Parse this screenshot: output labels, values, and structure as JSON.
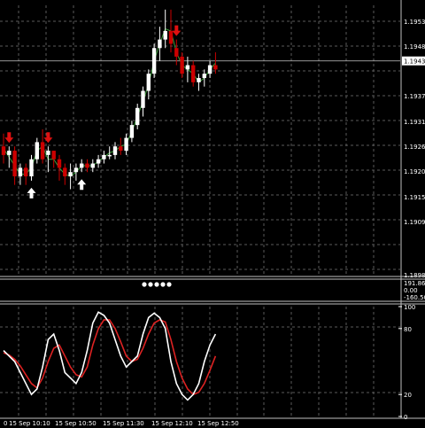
{
  "colors": {
    "background": "#000000",
    "grid": "#5a5a5a",
    "bull_candle": "#ffffff",
    "bear_candle": "#cc0000",
    "signal_line": "#3aa03a",
    "sell_arrow": "#e01010",
    "buy_arrow": "#ffffff",
    "stoch_main": "#ffffff",
    "stoch_signal": "#dd2222",
    "separator": "#c0c0c0"
  },
  "price_panel": {
    "ticks": [
      "1.1953",
      "1.1948",
      "1.1943",
      "1.1937",
      "1.1931",
      "1.1926",
      "1.1920",
      "1.1915",
      "1.1909",
      "1.1898"
    ],
    "current_price_label": "1.1943"
  },
  "middle_panel": {
    "ticks": [
      "191.86",
      "0.00",
      "-160.50"
    ],
    "dots": 5
  },
  "stochastic_panel": {
    "ticks": [
      "100",
      "80",
      "20",
      "0"
    ]
  },
  "time_axis": {
    "labels": [
      "0",
      "15 Sep 10:10",
      "15 Sep 10:50",
      "15 Sep 11:30",
      "15 Sep 12:10",
      "15 Sep 12:50"
    ]
  },
  "chart_data": {
    "type": "candlestick",
    "y_range": [
      1.1893,
      1.1956
    ],
    "candles": [
      [
        1.1923,
        1.1926,
        1.1919,
        1.1921
      ],
      [
        1.1921,
        1.1923,
        1.1918,
        1.1922
      ],
      [
        1.1922,
        1.1923,
        1.1914,
        1.1916
      ],
      [
        1.1916,
        1.1919,
        1.1914,
        1.1918
      ],
      [
        1.1918,
        1.1919,
        1.1914,
        1.1916
      ],
      [
        1.1916,
        1.1921,
        1.1915,
        1.192
      ],
      [
        1.192,
        1.1925,
        1.1919,
        1.1924
      ],
      [
        1.1924,
        1.1927,
        1.1919,
        1.192
      ],
      [
        1.1921,
        1.1923,
        1.1917,
        1.1922
      ],
      [
        1.1922,
        1.1922,
        1.1918,
        1.192
      ],
      [
        1.192,
        1.1921,
        1.1915,
        1.1918
      ],
      [
        1.1918,
        1.1919,
        1.1914,
        1.1916
      ],
      [
        1.1916,
        1.1919,
        1.1913,
        1.1917
      ],
      [
        1.1917,
        1.1919,
        1.1915,
        1.1918
      ],
      [
        1.1918,
        1.192,
        1.1917,
        1.1919
      ],
      [
        1.1919,
        1.192,
        1.1917,
        1.1918
      ],
      [
        1.1918,
        1.192,
        1.1917,
        1.1919
      ],
      [
        1.1919,
        1.1921,
        1.1918,
        1.192
      ],
      [
        1.192,
        1.1922,
        1.1919,
        1.1921
      ],
      [
        1.1921,
        1.1923,
        1.192,
        1.1921
      ],
      [
        1.1921,
        1.1924,
        1.192,
        1.1923
      ],
      [
        1.1923,
        1.1925,
        1.1921,
        1.1922
      ],
      [
        1.1922,
        1.1926,
        1.1921,
        1.1925
      ],
      [
        1.1925,
        1.1929,
        1.1924,
        1.1928
      ],
      [
        1.1928,
        1.1933,
        1.1927,
        1.1932
      ],
      [
        1.1932,
        1.1937,
        1.193,
        1.1936
      ],
      [
        1.1936,
        1.1941,
        1.1934,
        1.194
      ],
      [
        1.194,
        1.1947,
        1.1939,
        1.1946
      ],
      [
        1.1946,
        1.1951,
        1.1943,
        1.1948
      ],
      [
        1.1948,
        1.1955,
        1.1946,
        1.195
      ],
      [
        1.195,
        1.1955,
        1.1945,
        1.1947
      ],
      [
        1.1946,
        1.1948,
        1.1942,
        1.1944
      ],
      [
        1.1944,
        1.1945,
        1.1939,
        1.194
      ],
      [
        1.1941,
        1.1944,
        1.1938,
        1.1942
      ],
      [
        1.1942,
        1.1943,
        1.1937,
        1.1938
      ],
      [
        1.1938,
        1.194,
        1.1936,
        1.1939
      ],
      [
        1.1939,
        1.1941,
        1.1937,
        1.194
      ],
      [
        1.194,
        1.1943,
        1.1939,
        1.1942
      ],
      [
        1.1942,
        1.1945,
        1.194,
        1.1941
      ]
    ],
    "sell_arrows": [
      1,
      8,
      31
    ],
    "buy_arrows": [
      5,
      14
    ],
    "stoch_main": [
      60,
      55,
      50,
      40,
      30,
      20,
      25,
      45,
      70,
      75,
      60,
      40,
      35,
      30,
      40,
      60,
      85,
      95,
      92,
      85,
      70,
      55,
      45,
      50,
      55,
      75,
      90,
      94,
      90,
      80,
      50,
      30,
      20,
      15,
      20,
      30,
      50,
      65,
      75
    ],
    "stoch_signal": [
      58,
      56,
      52,
      46,
      38,
      30,
      26,
      35,
      50,
      62,
      65,
      55,
      45,
      38,
      36,
      45,
      65,
      80,
      88,
      88,
      80,
      68,
      55,
      50,
      52,
      62,
      75,
      85,
      88,
      86,
      70,
      50,
      35,
      25,
      20,
      22,
      30,
      42,
      55
    ]
  }
}
